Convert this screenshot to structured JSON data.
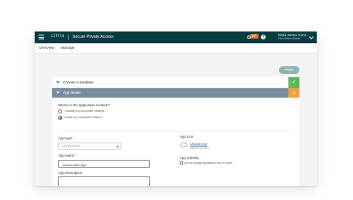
{
  "header": {
    "brand": "citrix",
    "app_title": "Secure Private Access",
    "notification_count": "99+",
    "help_icon": "?",
    "account_name": "Citrix Demo Cent...",
    "account_sub": "Citrix Demo Dealer"
  },
  "nav": {
    "tabs": [
      {
        "label": "Overview"
      },
      {
        "label": "Manage"
      }
    ]
  },
  "toolbar": {
    "finish_label": "Finish"
  },
  "wizard": {
    "step_template_label": "Choose a template",
    "step_template_status_icon": "✓",
    "section_label": "App details",
    "section_badge_icon": "⚠"
  },
  "form": {
    "location_question": "Where is the application located?",
    "required_mark": "*",
    "location_options": [
      {
        "label": "Outside my corporate network",
        "checked": false
      },
      {
        "label": "Inside my corporate network",
        "checked": true
      }
    ],
    "app_type_label": "App type",
    "app_type_value": "HTTP/HTTPS",
    "app_name_label": "App name",
    "app_name_value": "Internal Web App",
    "app_description_label": "App description",
    "app_icon_label": "App icon",
    "choose_file_label": "Choose icon",
    "file_hint": "(128 kb max, PNG)",
    "app_visibility_label": "App visibility",
    "hide_checkbox_label": "Do not display application icon to users"
  },
  "colors": {
    "topbar": "#0b3c42",
    "section_header": "#7a8da0",
    "success": "#5cb85c",
    "warning": "#f0a040",
    "finish_button": "#8fb4b3"
  },
  "icons": {
    "menu": "hamburger-icon",
    "notifications": "bell-icon",
    "help": "help-icon",
    "account_menu": "chevron-down-icon",
    "upload": "cloud-icon"
  }
}
